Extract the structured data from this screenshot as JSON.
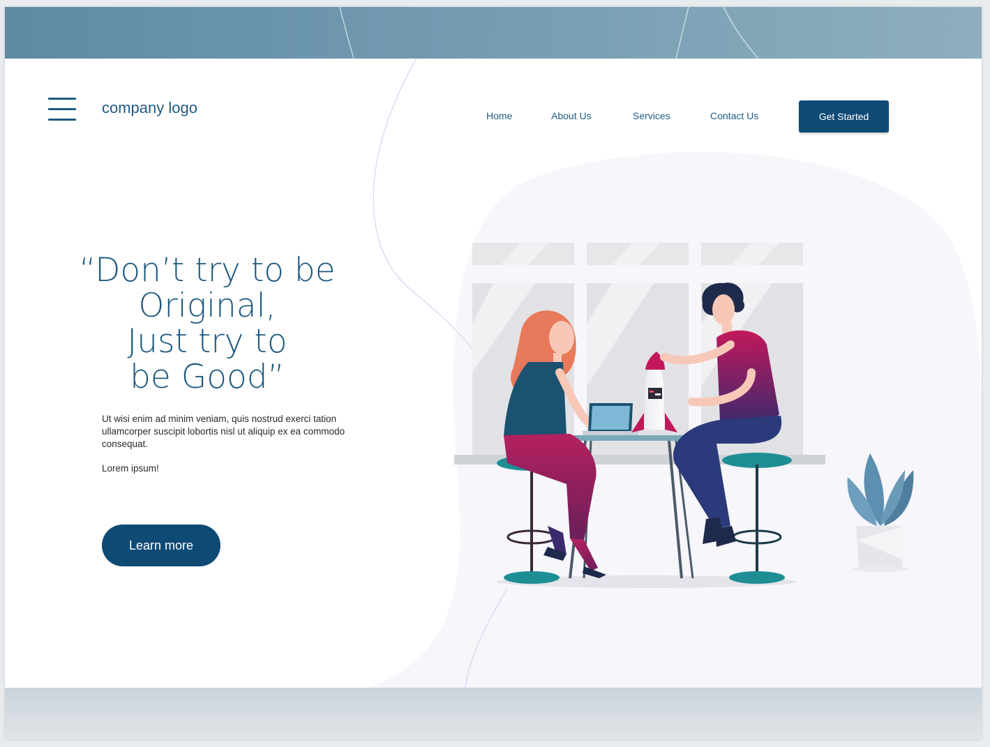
{
  "header": {
    "logo_text": "company logo",
    "nav": [
      {
        "label": "Home"
      },
      {
        "label": "About Us"
      },
      {
        "label": "Services"
      },
      {
        "label": "Contact Us"
      }
    ],
    "cta_label": "Get Started"
  },
  "hero": {
    "headline_lines": [
      "“Don’t try to be",
      "Original,",
      "Just try to",
      "be Good”"
    ],
    "body": "Ut wisi enim ad minim veniam, quis nostrud exerci tation ullamcorper suscipit lobortis nisl ut aliquip ex ea commodo consequat.",
    "tagline": "Lorem ipsum!",
    "button_label": "Learn more"
  },
  "colors": {
    "brand": "#0f4a75",
    "text_primary": "#1e5a80",
    "top_band": "#6f97ad",
    "bottom_band": "#d6dde2",
    "accent_magenta": "#b5205f",
    "accent_teal": "#1e8e95"
  },
  "icons": {
    "menu": "hamburger-menu-icon"
  }
}
